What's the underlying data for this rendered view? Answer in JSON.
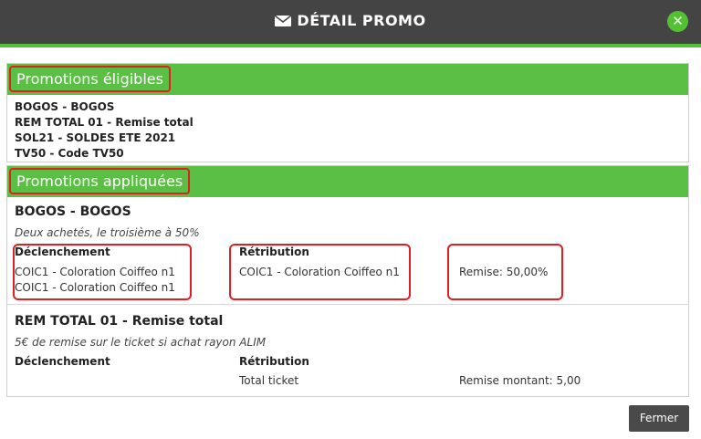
{
  "dialog": {
    "title": "DÉTAIL PROMO",
    "close_symbol": "✕"
  },
  "eligible": {
    "heading": "Promotions éligibles",
    "items": [
      "BOGOS - BOGOS",
      "REM TOTAL 01 - Remise total",
      "SOL21 - SOLDES ETE 2021",
      "TV50 - Code TV50"
    ]
  },
  "applied": {
    "heading": "Promotions appliquées",
    "promos": [
      {
        "title": "BOGOS - BOGOS",
        "description": "Deux achetés, le troisième à 50%",
        "trigger_label": "Déclenchement",
        "trigger_lines": [
          "COIC1 - Coloration Coiffeo n1",
          "COIC1 - Coloration Coiffeo n1"
        ],
        "reward_label": "Rétribution",
        "reward_line": "COIC1 - Coloration Coiffeo n1",
        "discount": "Remise: 50,00%"
      },
      {
        "title": "REM TOTAL 01 - Remise total",
        "description": "5€ de remise sur le ticket si achat rayon ALIM",
        "trigger_label": "Déclenchement",
        "reward_label": "Rétribution",
        "reward_line": "Total ticket",
        "discount": "Remise montant: 5,00"
      }
    ]
  },
  "footer": {
    "close_label": "Fermer"
  },
  "colors": {
    "header_bg": "#444444",
    "accent_green": "#5cbf45",
    "highlight_red": "#e02020"
  }
}
